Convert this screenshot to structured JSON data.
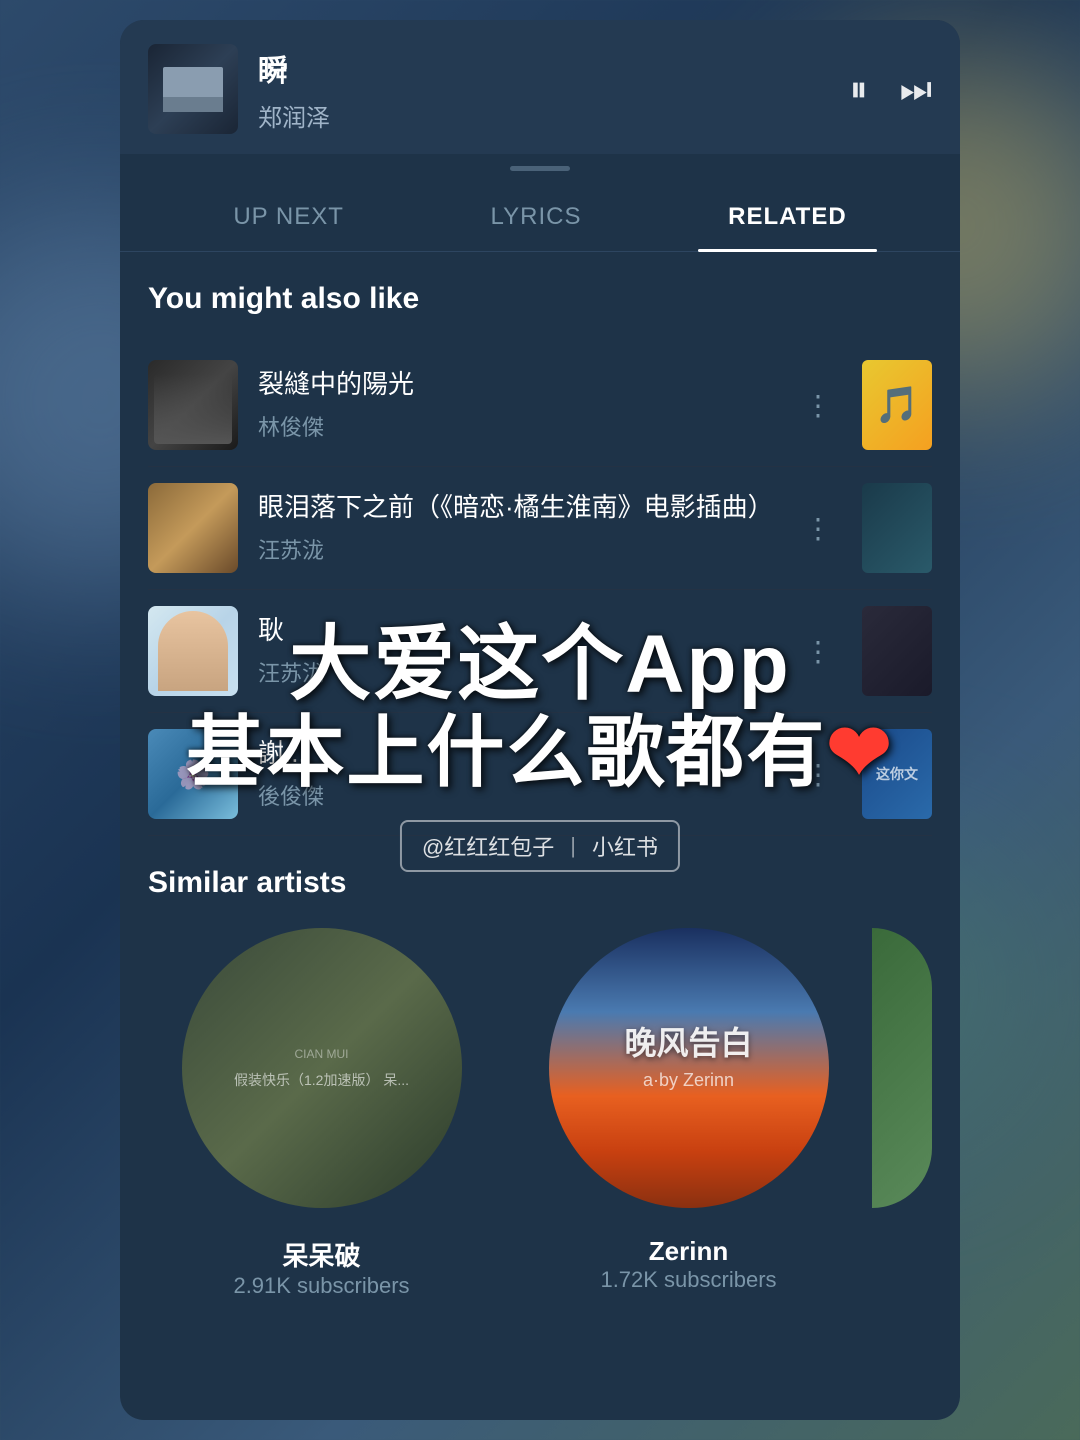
{
  "background": {
    "color": "#2d4a6b"
  },
  "nowPlaying": {
    "songTitle": "瞬",
    "artist": "郑润泽",
    "pauseIcon": "⏸",
    "nextIcon": "⏭"
  },
  "tabs": [
    {
      "id": "up-next",
      "label": "UP NEXT",
      "active": false
    },
    {
      "id": "lyrics",
      "label": "LYRICS",
      "active": false
    },
    {
      "id": "related",
      "label": "RELATED",
      "active": true
    }
  ],
  "related": {
    "youMightLike": {
      "title": "You might also like",
      "songs": [
        {
          "title": "裂縫中的陽光",
          "artist": "林俊傑"
        },
        {
          "title": "眼泪落下之前（《暗恋·橘生淮南》电影插曲）",
          "artist": "汪苏泷"
        },
        {
          "title": "耿",
          "artist": "汪苏泷"
        },
        {
          "title": "謝...",
          "artist": "後俊傑"
        }
      ]
    },
    "similarArtists": {
      "title": "Similar artists",
      "artists": [
        {
          "name": "呆呆破",
          "subscribers": "2.91K subscribers",
          "albumText": "假装快乐（1.2加速版）\n呆..."
        },
        {
          "name": "Zerinn",
          "subscribers": "1.72K subscribers",
          "albumText": "晚风告白"
        }
      ]
    }
  },
  "overlay": {
    "line1": "大爱这个App",
    "line2": "基本上什么歌都有",
    "heartEmoji": "❤"
  },
  "watermark": {
    "atText": "@红红红包子",
    "divider": "|",
    "site": "小红书"
  }
}
